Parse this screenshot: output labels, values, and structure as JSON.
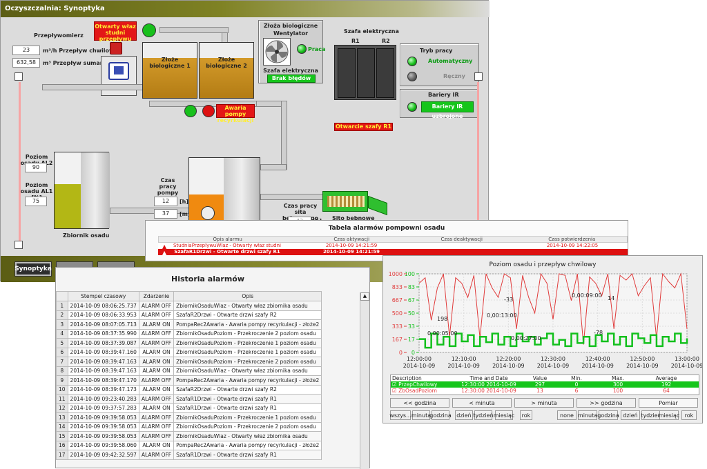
{
  "window": {
    "title": "Oczyszczalnia: Synoptyka"
  },
  "flowmeter": {
    "title": "Przepływomierz",
    "current_value": "23",
    "current_label": "m³/h Przepływ chwilowy",
    "total_value": "632,58",
    "total_label": "m³ Przepływ sumaryczny"
  },
  "alarms_top": {
    "hatch_open": "Otwarty właz studni przepływu",
    "pump_fault": "Awaria pompy recyrkulacji",
    "cabinet_open": "Otwarcie szafy R1"
  },
  "beds": {
    "bed1": "Złoże biologiczne 1",
    "bed2": "Złoże biologiczne 2"
  },
  "fan_panel": {
    "title": "Złoża biologiczne",
    "fan_label": "Wentylator",
    "state": "Praca",
    "cabinet_label": "Szafa elektryczna",
    "cabinet_status": "Brak błędów"
  },
  "cabinet": {
    "title": "Szafa elektryczna",
    "r1": "R1",
    "r2": "R2"
  },
  "mode_panel": {
    "title": "Tryb pracy",
    "auto": "Automatyczny",
    "manual": "Ręczny"
  },
  "ir_panel": {
    "title": "Bariery IR",
    "status": "Bariery IR uzbrojone"
  },
  "sludge": {
    "al2_label": "Poziom osadu AL2 [%]",
    "al2_value": "90",
    "al1_label": "Poziom osadu AL1 [%]",
    "al1_value": "75",
    "tank_label": "Zbiornik osadu",
    "fill_level": 0.58
  },
  "pump_time": {
    "label": "Czas pracy pompy osad",
    "h_value": "12",
    "h_unit": "[h]",
    "m_value": "37",
    "m_unit": "[m]",
    "fill_level": 0.42
  },
  "sieve": {
    "label": "Czas pracy sita bębnowego",
    "value": "42",
    "unit": "[h]",
    "name": "Sito bębnowe"
  },
  "nav": {
    "synoptyka": "Synoptyka"
  },
  "alarm_table": {
    "title": "Tabela alarmów pompowni osadu",
    "headers": [
      "Opis alarmu",
      "Czas aktywacji",
      "Czas deaktywacji",
      "Czas potwierdzenia"
    ],
    "rows": [
      {
        "desc": "StudniaPrzeplywuWlaz - Otwarty właz studni przepływowej",
        "active": "2014-10-09 14:21:59",
        "deactive": "",
        "confirm": "2014-10-09 14:22:05"
      },
      {
        "desc": "SzafaR1Drzwi - Otwarte drzwi szafy R1",
        "active": "2014-10-09 14:21:59",
        "deactive": "",
        "confirm": ""
      }
    ]
  },
  "history": {
    "title": "Historia alarmów",
    "headers": [
      "",
      "Stempel czasowy",
      "Zdarzenie",
      "Opis"
    ],
    "rows": [
      [
        "1",
        "2014-10-09 08:06:25.737",
        "ALARM OFF",
        "ZbiornikOsaduWlaz - Otwarty właz zbiornika osadu"
      ],
      [
        "2",
        "2014-10-09 08:06:33.953",
        "ALARM OFF",
        "SzafaR2Drzwi - Otwarte drzwi szafy R2"
      ],
      [
        "3",
        "2014-10-09 08:07:05.713",
        "ALARM ON",
        "PompaRec2Awaria - Awaria pompy recyrkulacji - złoże2"
      ],
      [
        "4",
        "2014-10-09 08:37:35.990",
        "ALARM OFF",
        "ZbiornikOsaduPoziom - Przekroczenie 2 poziom osadu"
      ],
      [
        "5",
        "2014-10-09 08:37:39.087",
        "ALARM OFF",
        "ZbiornikOsaduPoziom - Przekroczenie 1 poziom osadu"
      ],
      [
        "6",
        "2014-10-09 08:39:47.160",
        "ALARM ON",
        "ZbiornikOsaduPoziom - Przekroczenie 1 poziom osadu"
      ],
      [
        "7",
        "2014-10-09 08:39:47.163",
        "ALARM ON",
        "ZbiornikOsaduPoziom - Przekroczenie 2 poziom osadu"
      ],
      [
        "8",
        "2014-10-09 08:39:47.163",
        "ALARM ON",
        "ZbiornikOsaduWlaz - Otwarty właz zbiornika osadu"
      ],
      [
        "9",
        "2014-10-09 08:39:47.170",
        "ALARM OFF",
        "PompaRec2Awaria - Awaria pompy recyrkulacji - złoże2"
      ],
      [
        "10",
        "2014-10-09 08:39:47.173",
        "ALARM ON",
        "SzafaR2Drzwi - Otwarte drzwi szafy R2"
      ],
      [
        "11",
        "2014-10-09 09:23:40.283",
        "ALARM OFF",
        "SzafaR1Drzwi - Otwarte drzwi szafy R1"
      ],
      [
        "12",
        "2014-10-09 09:37:57.283",
        "ALARM ON",
        "SzafaR1Drzwi - Otwarte drzwi szafy R1"
      ],
      [
        "13",
        "2014-10-09 09:39:58.053",
        "ALARM OFF",
        "ZbiornikOsaduPoziom - Przekroczenie 1 poziom osadu"
      ],
      [
        "14",
        "2014-10-09 09:39:58.053",
        "ALARM OFF",
        "ZbiornikOsaduPoziom - Przekroczenie 2 poziom osadu"
      ],
      [
        "15",
        "2014-10-09 09:39:58.053",
        "ALARM OFF",
        "ZbiornikOsaduWlaz - Otwarty właz zbiornika osadu"
      ],
      [
        "16",
        "2014-10-09 09:39:58.060",
        "ALARM ON",
        "PompaRec2Awaria - Awaria pompy recyrkulacji - złoże2"
      ],
      [
        "17",
        "2014-10-09 09:42:32.597",
        "ALARM OFF",
        "SzafaR1Drzwi - Otwarte drzwi szafy R1"
      ]
    ]
  },
  "chart": {
    "title": "Poziom osadu i przepływ chwilowy",
    "red_ticks": [
      "1000",
      "833",
      "667",
      "500",
      "333",
      "167",
      "0"
    ],
    "green_ticks": [
      "100",
      "83",
      "67",
      "50",
      "33",
      "17",
      "0"
    ],
    "x_ticks": [
      {
        "t": "12:00:00",
        "d": "2014-10-09"
      },
      {
        "t": "12:10:00",
        "d": "2014-10-09"
      },
      {
        "t": "12:20:00",
        "d": "2014-10-09"
      },
      {
        "t": "12:30:00",
        "d": "2014-10-09"
      },
      {
        "t": "12:40:00",
        "d": "2014-10-09"
      },
      {
        "t": "12:50:00",
        "d": "2014-10-09"
      },
      {
        "t": "13:00:00",
        "d": "2014-10-09"
      }
    ],
    "annotations": [
      "-33",
      "0,00:09:00",
      "14",
      "198",
      "0,00:13:00",
      "0,00:05:00",
      "0,00:27:00",
      "-78"
    ],
    "colors": {
      "red": "#e03a3a",
      "green": "#12c01c"
    },
    "legend_headers": [
      "Description",
      "Time and Date",
      "Value",
      "Min.",
      "Max.",
      "Average"
    ],
    "legend_rows": [
      {
        "name": "PrzepChwilowy",
        "time": "12:30:00 2014-10-09",
        "value": "297",
        "min": "0",
        "max": "300",
        "avg": "192"
      },
      {
        "name": "ZbOsadPoziom",
        "time": "12:30:00 2014-10-09",
        "value": "13",
        "min": "6",
        "max": "100",
        "avg": "64"
      }
    ],
    "nav_buttons": [
      "<< godzina",
      "< minuta",
      "> minuta",
      ">> godzina",
      "Pomiar"
    ],
    "left_range": [
      "wszys...",
      "minuta",
      "godzina",
      "dzień",
      "tydzień",
      "miesiąc",
      "rok"
    ],
    "right_range": [
      "none",
      "minuta",
      "godzina",
      "dzień",
      "tydzień",
      "miesiąc",
      "rok"
    ]
  },
  "chart_data": [
    {
      "type": "line",
      "title": "Poziom osadu i przepływ chwilowy",
      "x_range": [
        "12:00:00",
        "13:00:00"
      ],
      "series": [
        {
          "name": "PrzepChwilowy",
          "axis": "red",
          "ylim": [
            0,
            1000
          ],
          "values": [
            880,
            950,
            410,
            820,
            1000,
            200,
            950,
            880,
            700,
            980,
            180,
            1000,
            820,
            700,
            1000,
            950,
            300,
            980,
            700,
            500,
            1000,
            880,
            420,
            1000,
            980,
            660,
            1000,
            100,
            960,
            880,
            720,
            1000,
            300,
            980,
            920,
            1000,
            720,
            850,
            950,
            180,
            1000,
            900,
            820,
            1000,
            300
          ]
        },
        {
          "name": "ZbOsadPoziom",
          "axis": "green",
          "ylim": [
            0,
            100
          ],
          "values": [
            17,
            6,
            24,
            10,
            20,
            8,
            24,
            14,
            22,
            8,
            20,
            13,
            24,
            10,
            20,
            8,
            24,
            14,
            20,
            10,
            18,
            24,
            10,
            16,
            8,
            24,
            12,
            20,
            8,
            22,
            14,
            24,
            10,
            20,
            8,
            24,
            18,
            12,
            22,
            8,
            20,
            14,
            24,
            12,
            18
          ]
        }
      ]
    }
  ]
}
